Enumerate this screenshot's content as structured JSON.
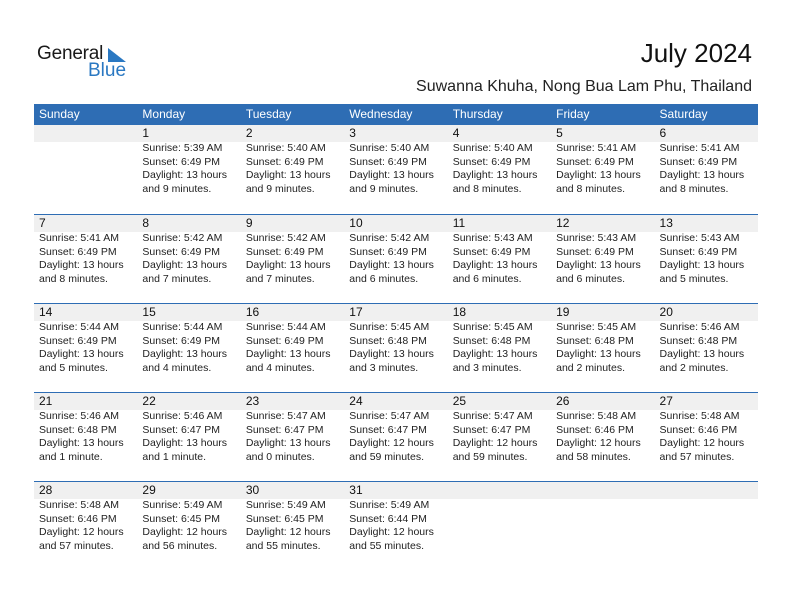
{
  "logo": {
    "general": "General",
    "blue": "Blue"
  },
  "header": {
    "title": "July 2024",
    "location": "Suwanna Khuha, Nong Bua Lam Phu, Thailand"
  },
  "colors": {
    "accent": "#2e6db4",
    "logo_blue": "#2a78c2",
    "band": "#f0f0f0"
  },
  "weekdays": [
    "Sunday",
    "Monday",
    "Tuesday",
    "Wednesday",
    "Thursday",
    "Friday",
    "Saturday"
  ],
  "weeks": [
    [
      null,
      {
        "day": "1",
        "sunrise": "Sunrise: 5:39 AM",
        "sunset": "Sunset: 6:49 PM",
        "daylight1": "Daylight: 13 hours",
        "daylight2": "and 9 minutes."
      },
      {
        "day": "2",
        "sunrise": "Sunrise: 5:40 AM",
        "sunset": "Sunset: 6:49 PM",
        "daylight1": "Daylight: 13 hours",
        "daylight2": "and 9 minutes."
      },
      {
        "day": "3",
        "sunrise": "Sunrise: 5:40 AM",
        "sunset": "Sunset: 6:49 PM",
        "daylight1": "Daylight: 13 hours",
        "daylight2": "and 9 minutes."
      },
      {
        "day": "4",
        "sunrise": "Sunrise: 5:40 AM",
        "sunset": "Sunset: 6:49 PM",
        "daylight1": "Daylight: 13 hours",
        "daylight2": "and 8 minutes."
      },
      {
        "day": "5",
        "sunrise": "Sunrise: 5:41 AM",
        "sunset": "Sunset: 6:49 PM",
        "daylight1": "Daylight: 13 hours",
        "daylight2": "and 8 minutes."
      },
      {
        "day": "6",
        "sunrise": "Sunrise: 5:41 AM",
        "sunset": "Sunset: 6:49 PM",
        "daylight1": "Daylight: 13 hours",
        "daylight2": "and 8 minutes."
      }
    ],
    [
      {
        "day": "7",
        "sunrise": "Sunrise: 5:41 AM",
        "sunset": "Sunset: 6:49 PM",
        "daylight1": "Daylight: 13 hours",
        "daylight2": "and 8 minutes."
      },
      {
        "day": "8",
        "sunrise": "Sunrise: 5:42 AM",
        "sunset": "Sunset: 6:49 PM",
        "daylight1": "Daylight: 13 hours",
        "daylight2": "and 7 minutes."
      },
      {
        "day": "9",
        "sunrise": "Sunrise: 5:42 AM",
        "sunset": "Sunset: 6:49 PM",
        "daylight1": "Daylight: 13 hours",
        "daylight2": "and 7 minutes."
      },
      {
        "day": "10",
        "sunrise": "Sunrise: 5:42 AM",
        "sunset": "Sunset: 6:49 PM",
        "daylight1": "Daylight: 13 hours",
        "daylight2": "and 6 minutes."
      },
      {
        "day": "11",
        "sunrise": "Sunrise: 5:43 AM",
        "sunset": "Sunset: 6:49 PM",
        "daylight1": "Daylight: 13 hours",
        "daylight2": "and 6 minutes."
      },
      {
        "day": "12",
        "sunrise": "Sunrise: 5:43 AM",
        "sunset": "Sunset: 6:49 PM",
        "daylight1": "Daylight: 13 hours",
        "daylight2": "and 6 minutes."
      },
      {
        "day": "13",
        "sunrise": "Sunrise: 5:43 AM",
        "sunset": "Sunset: 6:49 PM",
        "daylight1": "Daylight: 13 hours",
        "daylight2": "and 5 minutes."
      }
    ],
    [
      {
        "day": "14",
        "sunrise": "Sunrise: 5:44 AM",
        "sunset": "Sunset: 6:49 PM",
        "daylight1": "Daylight: 13 hours",
        "daylight2": "and 5 minutes."
      },
      {
        "day": "15",
        "sunrise": "Sunrise: 5:44 AM",
        "sunset": "Sunset: 6:49 PM",
        "daylight1": "Daylight: 13 hours",
        "daylight2": "and 4 minutes."
      },
      {
        "day": "16",
        "sunrise": "Sunrise: 5:44 AM",
        "sunset": "Sunset: 6:49 PM",
        "daylight1": "Daylight: 13 hours",
        "daylight2": "and 4 minutes."
      },
      {
        "day": "17",
        "sunrise": "Sunrise: 5:45 AM",
        "sunset": "Sunset: 6:48 PM",
        "daylight1": "Daylight: 13 hours",
        "daylight2": "and 3 minutes."
      },
      {
        "day": "18",
        "sunrise": "Sunrise: 5:45 AM",
        "sunset": "Sunset: 6:48 PM",
        "daylight1": "Daylight: 13 hours",
        "daylight2": "and 3 minutes."
      },
      {
        "day": "19",
        "sunrise": "Sunrise: 5:45 AM",
        "sunset": "Sunset: 6:48 PM",
        "daylight1": "Daylight: 13 hours",
        "daylight2": "and 2 minutes."
      },
      {
        "day": "20",
        "sunrise": "Sunrise: 5:46 AM",
        "sunset": "Sunset: 6:48 PM",
        "daylight1": "Daylight: 13 hours",
        "daylight2": "and 2 minutes."
      }
    ],
    [
      {
        "day": "21",
        "sunrise": "Sunrise: 5:46 AM",
        "sunset": "Sunset: 6:48 PM",
        "daylight1": "Daylight: 13 hours",
        "daylight2": "and 1 minute."
      },
      {
        "day": "22",
        "sunrise": "Sunrise: 5:46 AM",
        "sunset": "Sunset: 6:47 PM",
        "daylight1": "Daylight: 13 hours",
        "daylight2": "and 1 minute."
      },
      {
        "day": "23",
        "sunrise": "Sunrise: 5:47 AM",
        "sunset": "Sunset: 6:47 PM",
        "daylight1": "Daylight: 13 hours",
        "daylight2": "and 0 minutes."
      },
      {
        "day": "24",
        "sunrise": "Sunrise: 5:47 AM",
        "sunset": "Sunset: 6:47 PM",
        "daylight1": "Daylight: 12 hours",
        "daylight2": "and 59 minutes."
      },
      {
        "day": "25",
        "sunrise": "Sunrise: 5:47 AM",
        "sunset": "Sunset: 6:47 PM",
        "daylight1": "Daylight: 12 hours",
        "daylight2": "and 59 minutes."
      },
      {
        "day": "26",
        "sunrise": "Sunrise: 5:48 AM",
        "sunset": "Sunset: 6:46 PM",
        "daylight1": "Daylight: 12 hours",
        "daylight2": "and 58 minutes."
      },
      {
        "day": "27",
        "sunrise": "Sunrise: 5:48 AM",
        "sunset": "Sunset: 6:46 PM",
        "daylight1": "Daylight: 12 hours",
        "daylight2": "and 57 minutes."
      }
    ],
    [
      {
        "day": "28",
        "sunrise": "Sunrise: 5:48 AM",
        "sunset": "Sunset: 6:46 PM",
        "daylight1": "Daylight: 12 hours",
        "daylight2": "and 57 minutes."
      },
      {
        "day": "29",
        "sunrise": "Sunrise: 5:49 AM",
        "sunset": "Sunset: 6:45 PM",
        "daylight1": "Daylight: 12 hours",
        "daylight2": "and 56 minutes."
      },
      {
        "day": "30",
        "sunrise": "Sunrise: 5:49 AM",
        "sunset": "Sunset: 6:45 PM",
        "daylight1": "Daylight: 12 hours",
        "daylight2": "and 55 minutes."
      },
      {
        "day": "31",
        "sunrise": "Sunrise: 5:49 AM",
        "sunset": "Sunset: 6:44 PM",
        "daylight1": "Daylight: 12 hours",
        "daylight2": "and 55 minutes."
      },
      null,
      null,
      null
    ]
  ]
}
